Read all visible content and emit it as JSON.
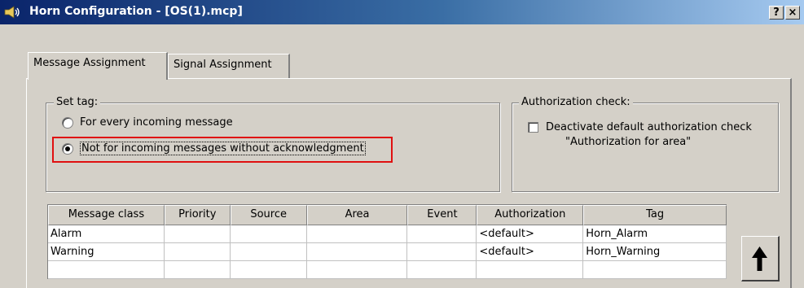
{
  "window": {
    "title": "Horn Configuration - [OS(1).mcp]",
    "help_label": "?",
    "close_label": "×"
  },
  "tabs": [
    {
      "label": "Message Assignment",
      "active": true
    },
    {
      "label": "Signal Assignment",
      "active": false
    }
  ],
  "set_tag": {
    "legend": "Set tag:",
    "options": [
      {
        "label": "For every incoming message",
        "checked": false
      },
      {
        "label": "Not for incoming messages without acknowledgment",
        "checked": true
      }
    ]
  },
  "authorization_check": {
    "legend": "Authorization check:",
    "checkbox_line1": "Deactivate default authorization check",
    "checkbox_line2": "\"Authorization for area\"",
    "checked": false
  },
  "table": {
    "columns": [
      "Message class",
      "Priority",
      "Source",
      "Area",
      "Event",
      "Authorization",
      "Tag"
    ],
    "rows": [
      [
        "Alarm",
        "",
        "",
        "",
        "",
        "<default>",
        "Horn_Alarm"
      ],
      [
        "Warning",
        "",
        "",
        "",
        "",
        "<default>",
        "Horn_Warning"
      ],
      [
        "",
        "",
        "",
        "",
        "",
        "",
        ""
      ]
    ]
  },
  "colors": {
    "highlight": "#e01010",
    "title_start": "#0a246a",
    "title_end": "#a6caf0",
    "window_bg": "#d4d0c8"
  }
}
